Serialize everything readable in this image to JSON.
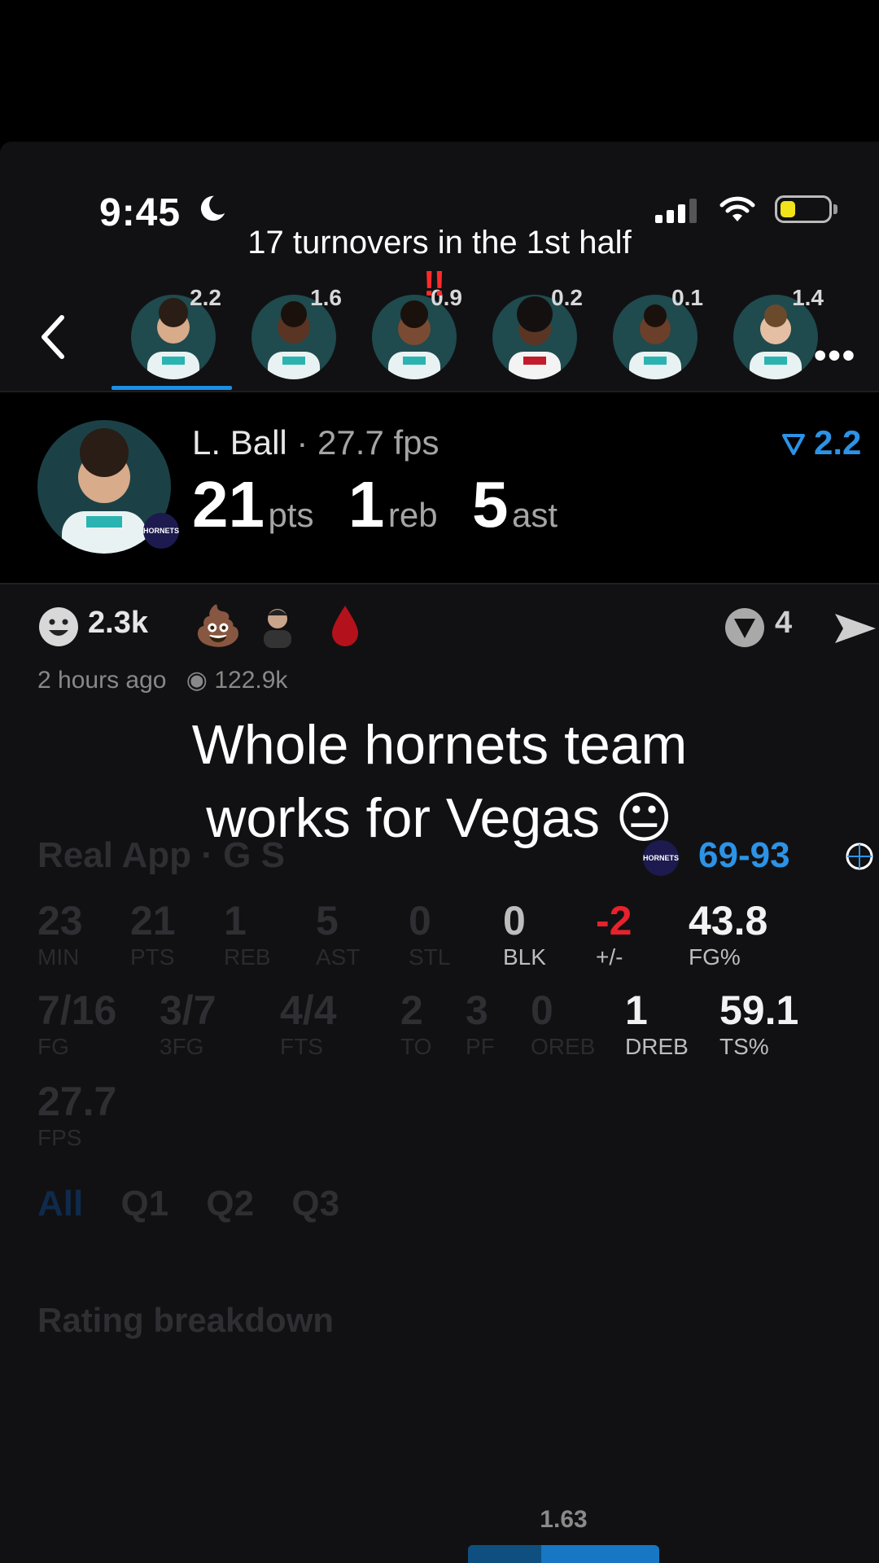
{
  "status_bar": {
    "time": "9:45"
  },
  "video_caption_top": "17 turnovers in the 1st half",
  "video_overlay_caption_line1": "Whole hornets team",
  "video_overlay_caption_line2": "works for Vegas 😐",
  "exclaim": "!!",
  "players": [
    {
      "rating": "2.2",
      "selected": true
    },
    {
      "rating": "1.6"
    },
    {
      "rating": "0.9"
    },
    {
      "rating": "0.2"
    },
    {
      "rating": "0.1"
    },
    {
      "rating": "1.4"
    }
  ],
  "more_label": "•••",
  "hero": {
    "name": "L. Ball",
    "fps": "· 27.7 fps",
    "pts": "21",
    "pts_unit": "pts",
    "reb": "1",
    "reb_unit": "reb",
    "ast": "5",
    "ast_unit": "ast",
    "rating": "2.2",
    "team_badge": "HORNETS"
  },
  "reactions": {
    "smile_count": "2.3k",
    "poop": "💩",
    "drop": "💧",
    "comment_count": "4"
  },
  "meta": {
    "ago": "2 hours ago",
    "views": "122.9k"
  },
  "body": {
    "app_label": "Real App · G S",
    "score": "69-93",
    "team_badge": "HORNETS",
    "row1": [
      {
        "v": "23",
        "l": "MIN"
      },
      {
        "v": "21",
        "l": "PTS"
      },
      {
        "v": "1",
        "l": "REB"
      },
      {
        "v": "5",
        "l": "AST"
      },
      {
        "v": "0",
        "l": "STL"
      },
      {
        "v": "0",
        "l": "BLK"
      },
      {
        "v": "-2",
        "l": "+/-"
      },
      {
        "v": "43.8",
        "l": "FG%"
      }
    ],
    "row2": [
      {
        "v": "7/16",
        "l": "FG"
      },
      {
        "v": "3/7",
        "l": "3FG"
      },
      {
        "v": "4/4",
        "l": "FTS"
      },
      {
        "v": "2",
        "l": "TO"
      },
      {
        "v": "3",
        "l": "PF"
      },
      {
        "v": "0",
        "l": "OREB"
      },
      {
        "v": "1",
        "l": "DREB"
      },
      {
        "v": "59.1",
        "l": "TS%"
      }
    ],
    "row3": {
      "v": "27.7",
      "l": "FPS"
    },
    "tabs": [
      "All",
      "Q1",
      "Q2",
      "Q3"
    ],
    "rating_breakdown": "Rating breakdown",
    "bar_value": "1.63"
  },
  "colors": {
    "accent_blue": "#2c93e6",
    "negative_red": "#e6222d",
    "bg": "#000000"
  }
}
